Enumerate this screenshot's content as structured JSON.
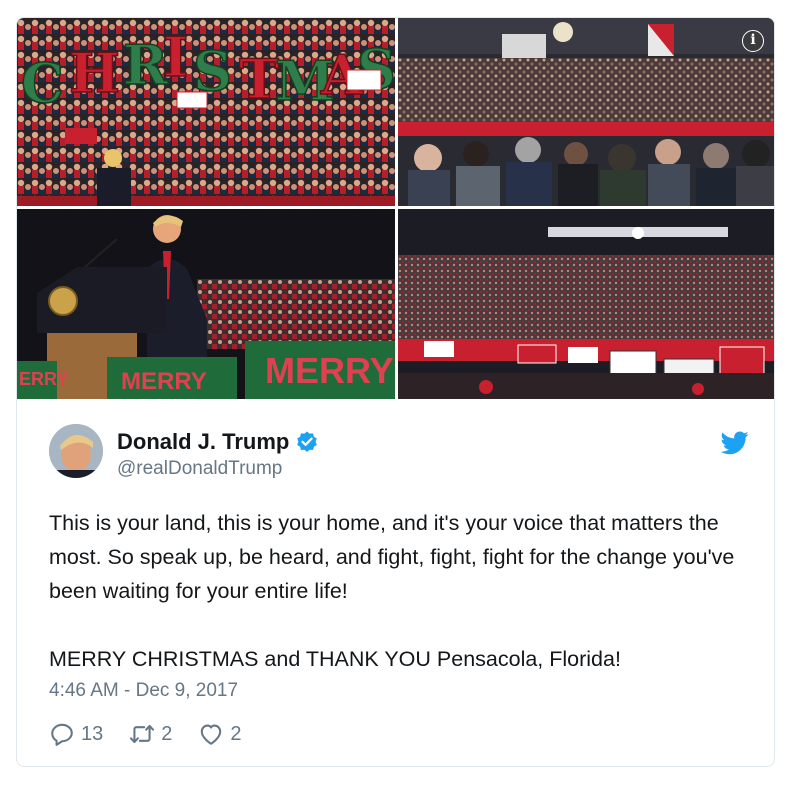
{
  "media": {
    "images": [
      {
        "name": "rally-christmas-sign-photo",
        "sign_text": "CHRISTMAS"
      },
      {
        "name": "rally-arena-crowd-photo"
      },
      {
        "name": "speaker-at-podium-photo",
        "banner_text": "MERRY"
      },
      {
        "name": "arena-wide-crowd-photo"
      }
    ]
  },
  "tweet": {
    "display_name": "Donald J. Trump",
    "handle": "@realDonaldTrump",
    "paragraphs": [
      "This is your land, this is your home, and it's your voice that matters the most. So speak up, be heard, and fight, fight, fight for the change you've been waiting for your entire life!",
      "MERRY CHRISTMAS and THANK YOU Pensacola, Florida!"
    ],
    "timestamp": "4:46 AM - Dec 9, 2017",
    "reply_count": "13",
    "retweet_count": "2",
    "like_count": "2"
  },
  "icons": {
    "info": "i"
  },
  "colors": {
    "twitter_blue": "#1da1f2",
    "verified_blue": "#1da1f2",
    "muted": "#657786",
    "text": "#14171a",
    "banner_green": "#1f6b3a",
    "banner_red": "#c8202f"
  }
}
